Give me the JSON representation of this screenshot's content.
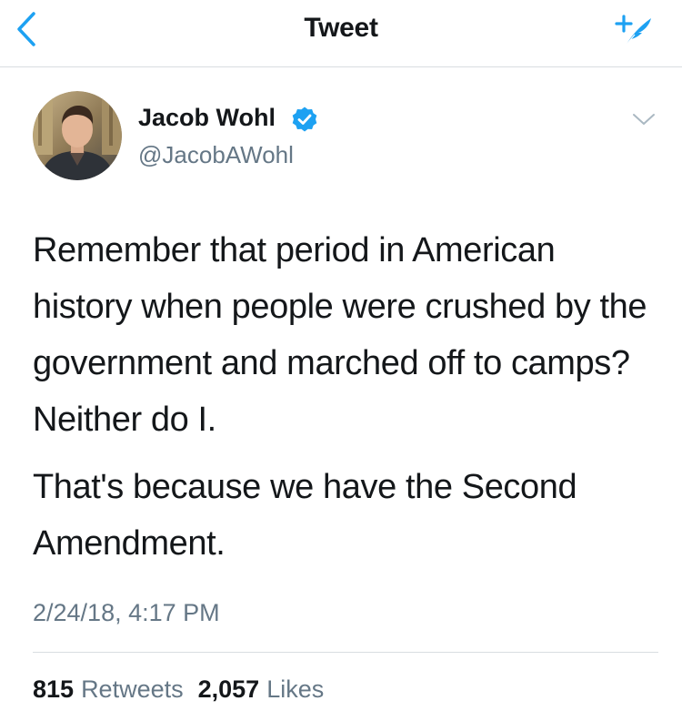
{
  "colors": {
    "accent": "#1da1f2",
    "text_primary": "#14171a",
    "text_secondary": "#657786",
    "divider": "#d9dde1"
  },
  "navbar": {
    "title": "Tweet",
    "back_icon": "chevron-left-icon",
    "compose_icon": "compose-tweet-icon"
  },
  "tweet": {
    "author": {
      "name": "Jacob Wohl",
      "handle": "@JacobAWohl",
      "verified": true
    },
    "paragraphs": [
      "Remember that period in American history when people were crushed by the government and marched off to camps? Neither do I.",
      "That's because we have the Second Amendment."
    ],
    "timestamp": "2/24/18, 4:17 PM",
    "stats": {
      "retweets_count": "815",
      "retweets_label": "Retweets",
      "likes_count": "2,057",
      "likes_label": "Likes"
    }
  }
}
